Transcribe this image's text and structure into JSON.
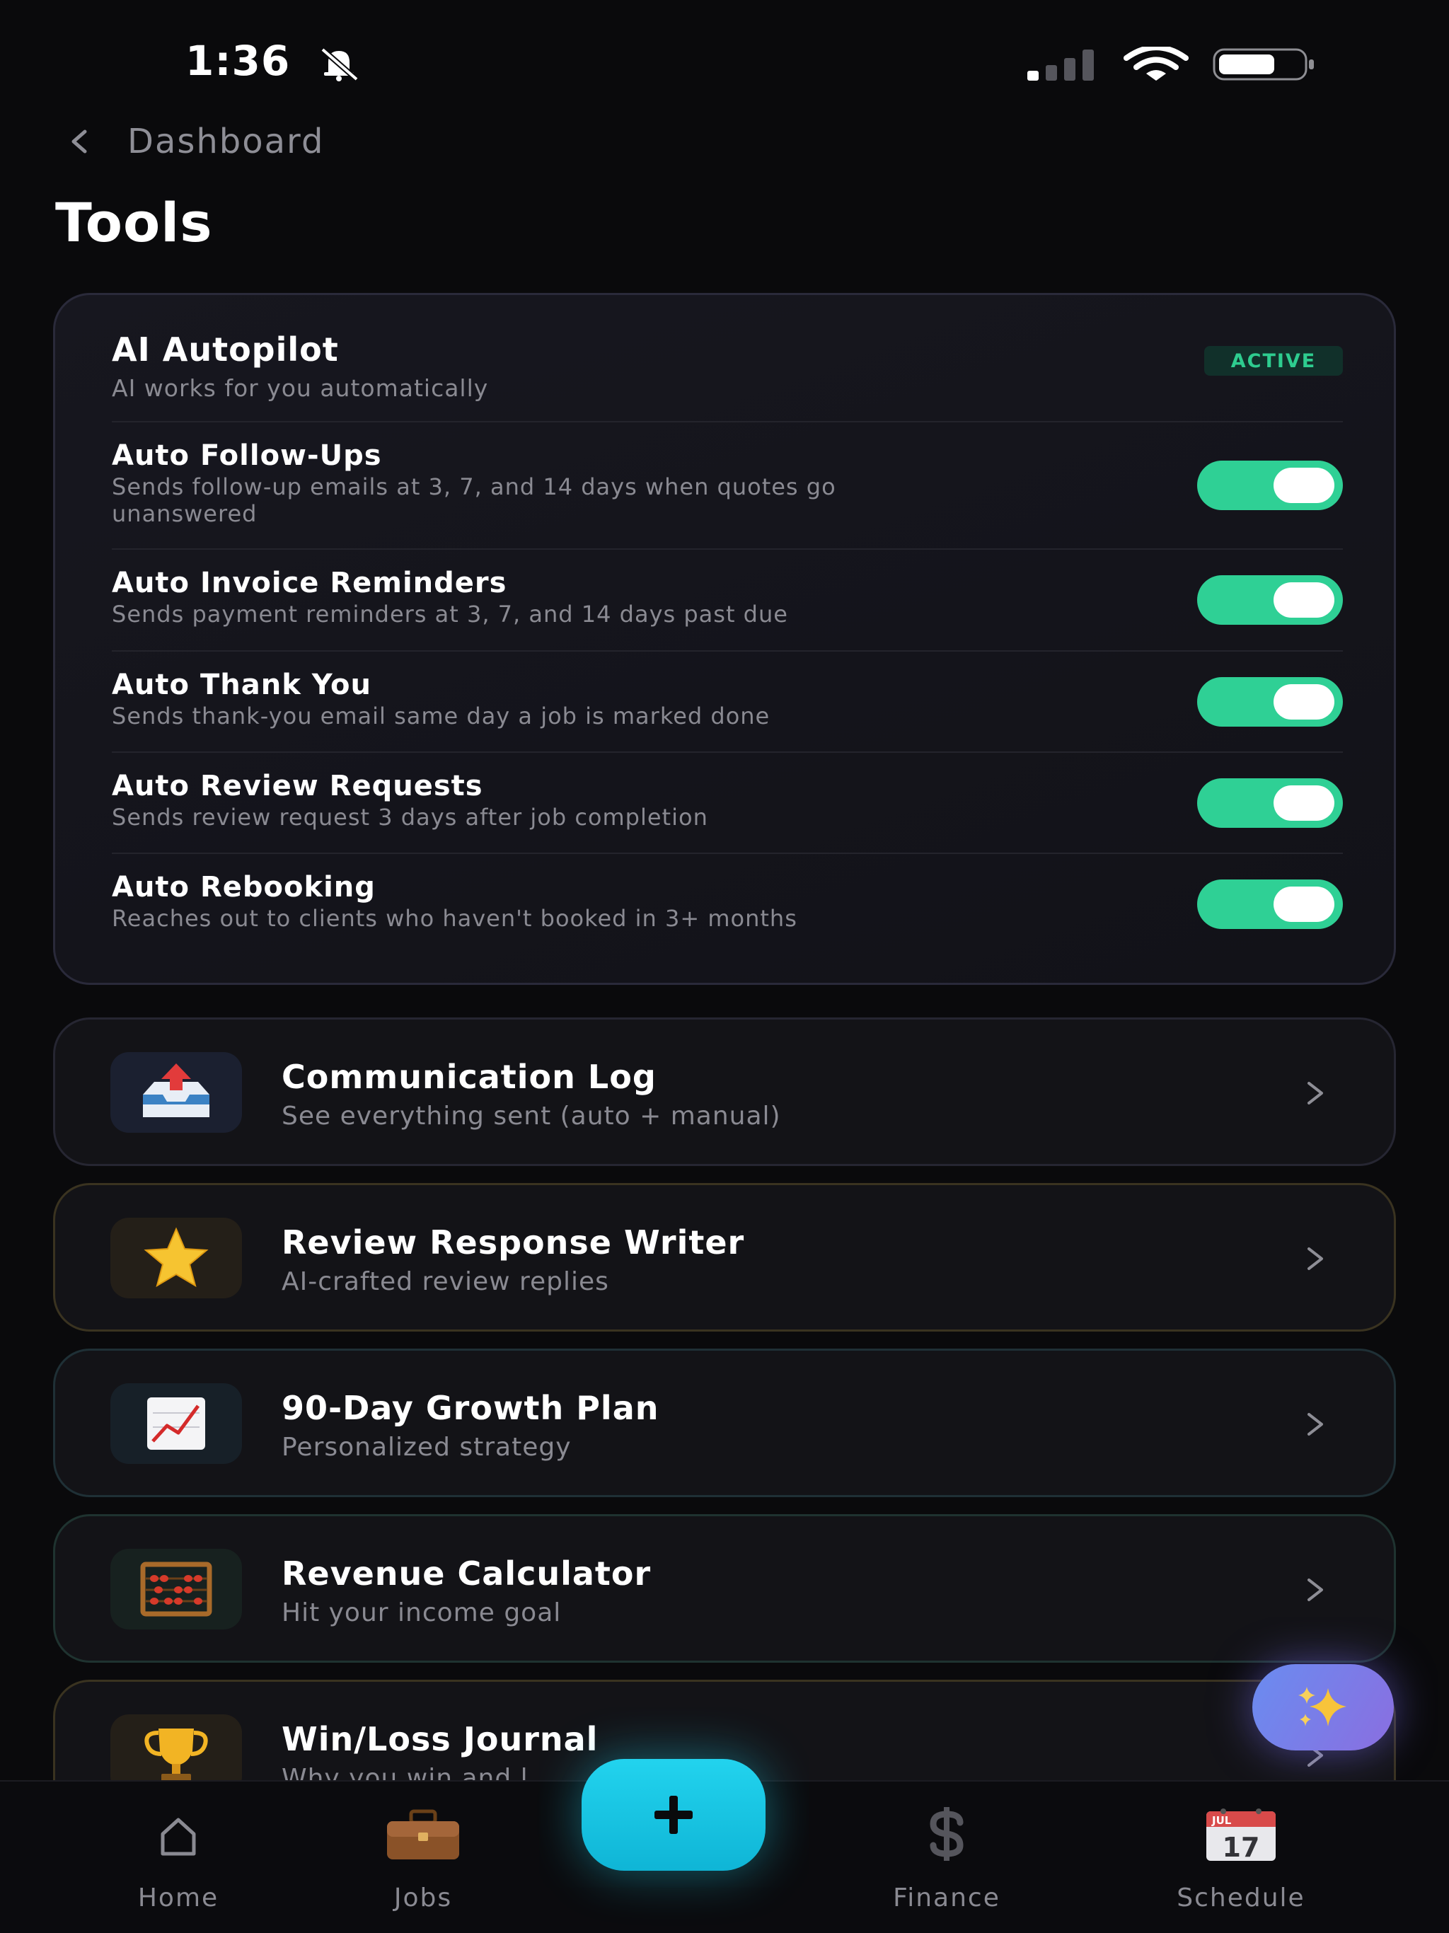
{
  "status_bar": {
    "time": "1:36"
  },
  "header": {
    "back_label": "Dashboard",
    "title": "Tools"
  },
  "autopilot": {
    "title": "AI Autopilot",
    "subtitle": "AI works for you automatically",
    "badge": "ACTIVE",
    "items": [
      {
        "title": "Auto Follow-Ups",
        "desc": "Sends follow-up emails at 3, 7, and 14 days when quotes go",
        "desc2": "unanswered",
        "enabled": true
      },
      {
        "title": "Auto Invoice Reminders",
        "desc": "Sends payment reminders at 3, 7, and 14 days past due",
        "enabled": true
      },
      {
        "title": "Auto Thank You",
        "desc": "Sends thank-you email same day a job is marked done",
        "enabled": true
      },
      {
        "title": "Auto Review Requests",
        "desc": "Sends review request 3 days after job completion",
        "enabled": true
      },
      {
        "title": "Auto Rebooking",
        "desc": "Reaches out to clients who haven't booked in 3+ months",
        "enabled": true
      }
    ]
  },
  "tools": [
    {
      "title": "Communication Log",
      "desc": "See everything sent (auto + manual)",
      "icon": "outbox-tray-icon"
    },
    {
      "title": "Review Response Writer",
      "desc": "AI-crafted review replies",
      "icon": "star-icon"
    },
    {
      "title": "90-Day Growth Plan",
      "desc": "Personalized strategy",
      "icon": "chart-increasing-icon"
    },
    {
      "title": "Revenue Calculator",
      "desc": "Hit your income goal",
      "icon": "abacus-icon"
    },
    {
      "title": "Win/Loss Journal",
      "desc": "Why you win and l",
      "icon": "trophy-icon"
    }
  ],
  "nav": {
    "home": "Home",
    "jobs": "Jobs",
    "add": "+",
    "finance": "Finance",
    "schedule": "Schedule",
    "calendar_month": "JUL",
    "calendar_day": "17"
  },
  "colors": {
    "accent_green": "#2fd095",
    "accent_cyan": "#22d3ee",
    "background": "#0a0a0c"
  }
}
